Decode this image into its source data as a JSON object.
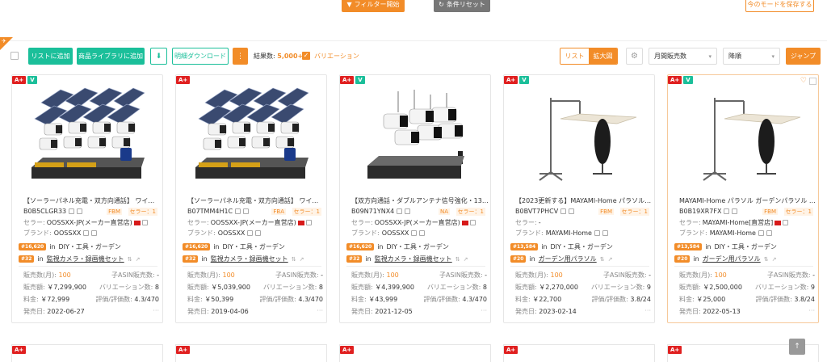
{
  "topbar": {
    "filter_label": "フィルター開始",
    "reset_label": "条件リセット",
    "save_label": "今のモードを保存する"
  },
  "corner": {
    "label": "✈"
  },
  "toolbar": {
    "add_list": "リストに追加",
    "add_library": "商品ライブラリに追加",
    "download_icon": "⬇",
    "detail_download": "明細ダウンロード",
    "more": "⋮",
    "result_label": "結果数:",
    "result_count": "5,000+",
    "variation_label": "バリエーション",
    "view_list": "リスト",
    "view_large": "拡大図",
    "gear": "⚙",
    "sort_field": "月間販売数",
    "sort_order": "降順",
    "jump": "ジャンプ"
  },
  "labels": {
    "seller": "セラー:",
    "brand": "ブランド:",
    "in": "in",
    "monthly_sales": "販売数(月):",
    "child_asin_sales": "子ASIN販売数:",
    "sales_amount": "販売額:",
    "variation_count": "バリエーション数:",
    "price": "料金:",
    "rating": "評価/評価数:",
    "release": "発売日:"
  },
  "cards": [
    {
      "badges": [
        "A+",
        "V"
      ],
      "title": "【ソーラーパネル充電・双方向通話】 ワイヤ…",
      "asin": "B0B5CLGR33",
      "fulfill": "FBM",
      "seller_count": "セラー：1",
      "seller": "OOSSXX-JP(メーカー直営店)",
      "brand": "OOSSXX",
      "rank1_badge": "#16,620",
      "rank1_cat": "DIY・工具・ガーデン",
      "rank2_badge": "#32",
      "rank2_cat": "監視カメラ・録画機セット",
      "monthly_sales": "100",
      "child_asin_sales": "-",
      "sales_amount": "￥7,299,900",
      "variation_count": "8",
      "price": "￥72,999",
      "rating": "4.3/470",
      "release": "2022-06-27",
      "image": "solar-camera"
    },
    {
      "badges": [
        "A+"
      ],
      "title": "【ソーラーパネル充電・双方向通話】 ワイヤ…",
      "asin": "B07TMM4H1C",
      "fulfill": "FBA",
      "seller_count": "セラー：1",
      "seller": "OOSSXX-JP(メーカー直営店)",
      "brand": "OOSSXX",
      "rank1_badge": "#16,620",
      "rank1_cat": "DIY・工具・ガーデン",
      "rank2_badge": "#32",
      "rank2_cat": "監視カメラ・録画機セット",
      "monthly_sales": "100",
      "child_asin_sales": "-",
      "sales_amount": "￥5,039,900",
      "variation_count": "8",
      "price": "￥50,399",
      "rating": "4.3/470",
      "release": "2019-04-06",
      "image": "solar-camera"
    },
    {
      "badges": [
        "A+",
        "V"
      ],
      "title": "【双方向通話・ダブルアンテナ信号強化・130…",
      "asin": "B09N71YNX4",
      "fulfill": "NA",
      "seller_count": "セラー：1",
      "seller": "OOSSXX-JP(メーカー直営店)",
      "brand": "OOSSXX",
      "rank1_badge": "#16,620",
      "rank1_cat": "DIY・工具・ガーデン",
      "rank2_badge": "#32",
      "rank2_cat": "監視カメラ・録画機セット",
      "monthly_sales": "100",
      "child_asin_sales": "-",
      "sales_amount": "￥4,399,900",
      "variation_count": "8",
      "price": "￥43,999",
      "rating": "4.3/470",
      "release": "2021-12-05",
      "image": "wifi-camera"
    },
    {
      "badges": [
        "A+",
        "V"
      ],
      "title": "【2023更新する】MAYAMI-Home パラソル …",
      "asin": "B0BVT7PHCV",
      "fulfill": "FBM",
      "seller_count": "セラー：1",
      "seller": "-",
      "brand": "MAYAMI-Home",
      "rank1_badge": "#13,584",
      "rank1_cat": "DIY・工具・ガーデン",
      "rank2_badge": "#20",
      "rank2_cat": "ガーデン用パラソル",
      "monthly_sales": "100",
      "child_asin_sales": "-",
      "sales_amount": "￥2,270,000",
      "variation_count": "9",
      "price": "￥22,700",
      "rating": "3.8/24",
      "release": "2023-02-14",
      "image": "parasol"
    },
    {
      "badges": [
        "A+",
        "V"
      ],
      "title": "MAYAMI-Home パラソル ガーデンパラソル 2…",
      "asin": "B0B19XR7FX",
      "fulfill": "FBM",
      "seller_count": "セラー：1",
      "seller": "MAYAMI-Home[直営店]",
      "brand": "MAYAMI-Home",
      "rank1_badge": "#13,584",
      "rank1_cat": "DIY・工具・ガーデン",
      "rank2_badge": "#20",
      "rank2_cat": "ガーデン用パラソル",
      "monthly_sales": "100",
      "child_asin_sales": "-",
      "sales_amount": "￥2,500,000",
      "variation_count": "9",
      "price": "￥25,000",
      "rating": "3.8/24",
      "release": "2022-05-13",
      "image": "parasol"
    }
  ],
  "bottom_badges": [
    "A+",
    "A+",
    "A+",
    "A+",
    "A+"
  ],
  "scroll_top": "↑",
  "colors": {
    "accent": "#f28c28",
    "green": "#1bbf9a",
    "red": "#e02020"
  }
}
